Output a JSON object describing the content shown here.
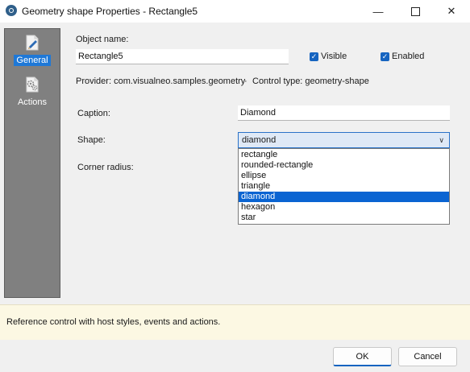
{
  "window": {
    "title": "Geometry shape Properties - Rectangle5",
    "minimize_glyph": "—",
    "close_glyph": "✕"
  },
  "sidebar": {
    "items": [
      {
        "label": "General",
        "icon": "pencil-page-icon",
        "selected": true
      },
      {
        "label": "Actions",
        "icon": "gears-page-icon",
        "selected": false
      }
    ]
  },
  "general": {
    "object_name_label": "Object name:",
    "object_name_value": "Rectangle5",
    "visible_label": "Visible",
    "visible_checked": true,
    "enabled_label": "Enabled",
    "enabled_checked": true,
    "provider_text": "Provider: com.visualneo.samples.geometry",
    "separator": "·",
    "control_type_text": "Control type: geometry-shape",
    "caption_label": "Caption:",
    "caption_value": "Diamond",
    "shape_label": "Shape:",
    "shape_value": "diamond",
    "shape_options": [
      "rectangle",
      "rounded-rectangle",
      "ellipse",
      "triangle",
      "diamond",
      "hexagon",
      "star"
    ],
    "shape_selected_index": 4,
    "corner_radius_label": "Corner radius:"
  },
  "description": "Reference control with host styles, events and actions.",
  "buttons": {
    "ok": "OK",
    "cancel": "Cancel"
  },
  "colors": {
    "accent": "#1664c0",
    "selection": "#0a64d2",
    "sidebar": "#808080",
    "info_panel": "#fcf8e3"
  }
}
